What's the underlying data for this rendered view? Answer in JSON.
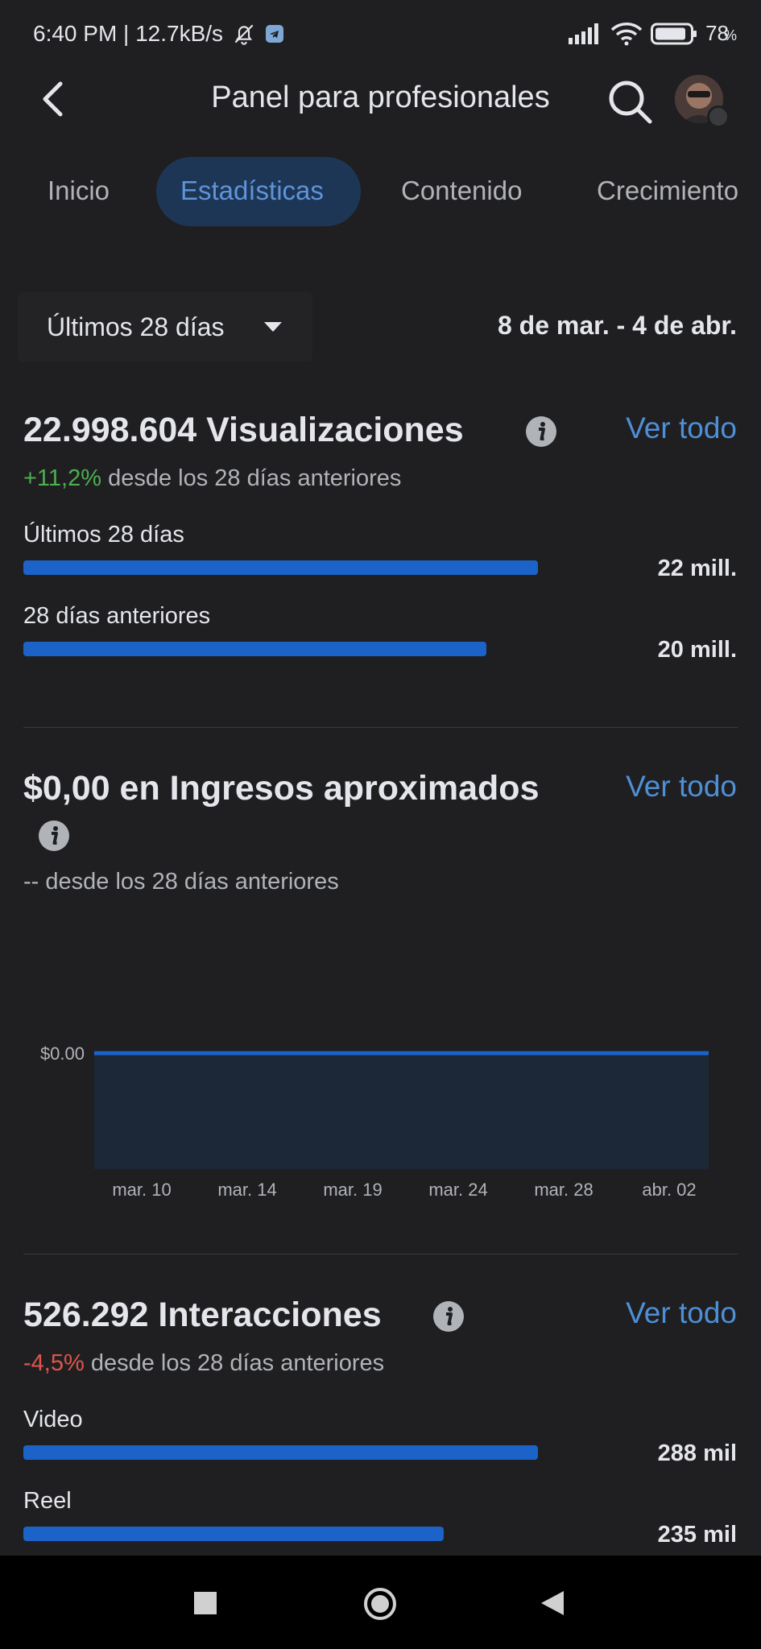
{
  "status_bar": {
    "time_speed": "6:40 PM | 12.7kB/s",
    "battery": "78",
    "battery_unit": "%"
  },
  "header": {
    "title": "Panel para profesionales"
  },
  "tabs": [
    {
      "label": "Inicio"
    },
    {
      "label": "Estadísticas",
      "active": true
    },
    {
      "label": "Contenido"
    },
    {
      "label": "Crecimiento"
    }
  ],
  "period": {
    "selector_label": "Últimos 28 días",
    "date_range": "8 de mar. - 4 de abr."
  },
  "views": {
    "title": "22.998.604 Visualizaciones",
    "see_all": "Ver todo",
    "change": "+11,2%",
    "change_text": " desde los 28 días anteriores",
    "rows": [
      {
        "label": "Últimos 28 días",
        "value": "22 mill.",
        "fraction": 1.0
      },
      {
        "label": "28 días anteriores",
        "value": "20 mill.",
        "fraction": 0.9
      }
    ]
  },
  "earnings": {
    "title": "$0,00 en Ingresos aproximados",
    "see_all": "Ver todo",
    "sub": "-- desde los 28 días anteriores"
  },
  "chart_data": {
    "type": "area",
    "x": [
      "mar. 10",
      "mar. 14",
      "mar. 19",
      "mar. 24",
      "mar. 28",
      "abr. 02"
    ],
    "series": [
      {
        "values": [
          0,
          0,
          0,
          0,
          0,
          0
        ]
      }
    ],
    "y_tick_labels": [
      "$0.00"
    ],
    "colors": {
      "line": "#1b63c8",
      "fill": "#1c2837"
    }
  },
  "interactions": {
    "title": "526.292 Interacciones",
    "see_all": "Ver todo",
    "change": "-4,5%",
    "change_text": " desde los 28 días anteriores",
    "rows": [
      {
        "label": "Video",
        "value": "288 mil",
        "fraction": 1.0
      },
      {
        "label": "Reel",
        "value": "235 mil",
        "fraction": 0.816
      }
    ]
  },
  "colors": {
    "accent": "#4e8fd6",
    "bar": "#1b63c8",
    "positive": "#4caf50",
    "negative": "#e0554b"
  },
  "icons": [
    "notifications-off-icon",
    "telegram-icon",
    "signal-icon",
    "wifi-icon",
    "battery-icon",
    "back-arrow-icon",
    "search-icon",
    "info-icon",
    "square-nav-icon",
    "circle-nav-icon",
    "triangle-back-nav-icon"
  ]
}
